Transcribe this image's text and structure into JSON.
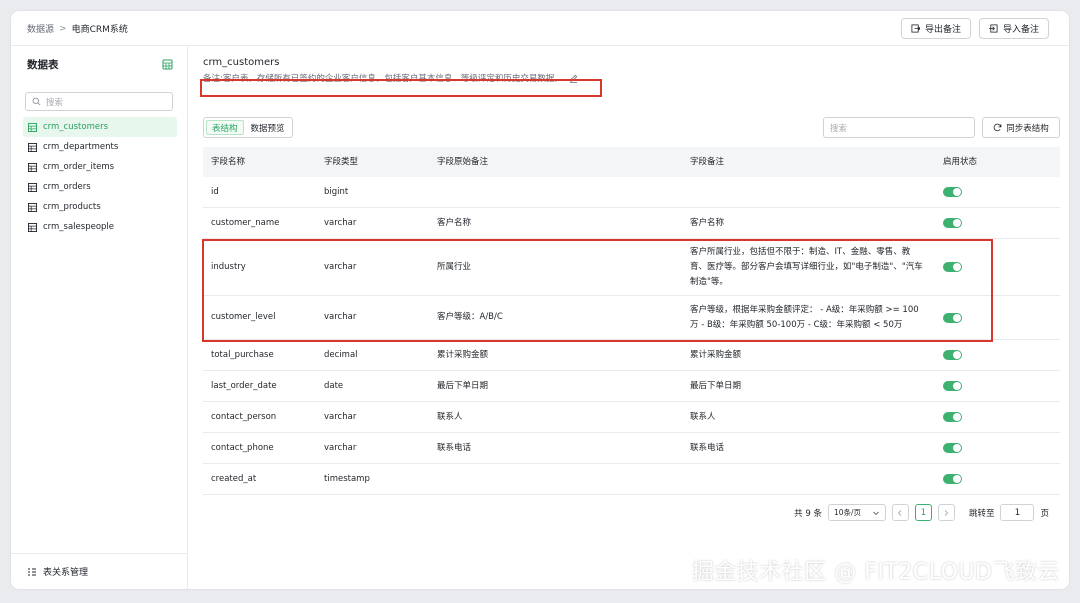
{
  "header": {
    "breadcrumb_root": "数据源",
    "breadcrumb_sep": ">",
    "breadcrumb_current": "电商CRM系统",
    "export_label": "导出备注",
    "import_label": "导入备注"
  },
  "sidebar": {
    "title": "数据表",
    "search_placeholder": "搜索",
    "items": [
      {
        "label": "crm_customers"
      },
      {
        "label": "crm_departments"
      },
      {
        "label": "crm_order_items"
      },
      {
        "label": "crm_orders"
      },
      {
        "label": "crm_products"
      },
      {
        "label": "crm_salespeople"
      }
    ],
    "footer_label": "表关系管理"
  },
  "main": {
    "table_name": "crm_customers",
    "remark": "备注:客户表，存储所有已签约的企业客户信息，包括客户基本信息、等级评定和历史交易数据。",
    "tabs": [
      {
        "label": "表结构"
      },
      {
        "label": "数据预览"
      }
    ],
    "search_placeholder": "搜索",
    "sync_label": "同步表结构"
  },
  "grid": {
    "headers": [
      "字段名称",
      "字段类型",
      "字段原始备注",
      "字段备注",
      "启用状态"
    ],
    "rows": [
      {
        "name": "id",
        "type": "bigint",
        "orig": "",
        "note": "",
        "enabled": true
      },
      {
        "name": "customer_name",
        "type": "varchar",
        "orig": "客户名称",
        "note": "客户名称",
        "enabled": true
      },
      {
        "name": "industry",
        "type": "varchar",
        "orig": "所属行业",
        "note": "客户所属行业，包括但不限于：制造、IT、金融、零售、教育、医疗等。部分客户会填写详细行业，如\"电子制造\"、\"汽车制造\"等。",
        "enabled": true
      },
      {
        "name": "customer_level",
        "type": "varchar",
        "orig": "客户等级：A/B/C",
        "note": "客户等级，根据年采购金额评定： - A级：年采购额 >= 100万 - B级：年采购额 50-100万 - C级：年采购额 < 50万",
        "enabled": true
      },
      {
        "name": "total_purchase",
        "type": "decimal",
        "orig": "累计采购金额",
        "note": "累计采购金额",
        "enabled": true
      },
      {
        "name": "last_order_date",
        "type": "date",
        "orig": "最后下单日期",
        "note": "最后下单日期",
        "enabled": true
      },
      {
        "name": "contact_person",
        "type": "varchar",
        "orig": "联系人",
        "note": "联系人",
        "enabled": true
      },
      {
        "name": "contact_phone",
        "type": "varchar",
        "orig": "联系电话",
        "note": "联系电话",
        "enabled": true
      },
      {
        "name": "created_at",
        "type": "timestamp",
        "orig": "",
        "note": "",
        "enabled": true
      }
    ]
  },
  "pagination": {
    "total": "共 9 条",
    "page_size": "10条/页",
    "current_page": "1",
    "goto_label": "跳转至",
    "goto_value": "1",
    "page_suffix": "页"
  },
  "watermark": "掘金技术社区 @ FIT2CLOUD飞致云",
  "colors": {
    "accent": "#2aa15f",
    "toggle": "#3eb06f",
    "highlight": "#d9372c"
  }
}
